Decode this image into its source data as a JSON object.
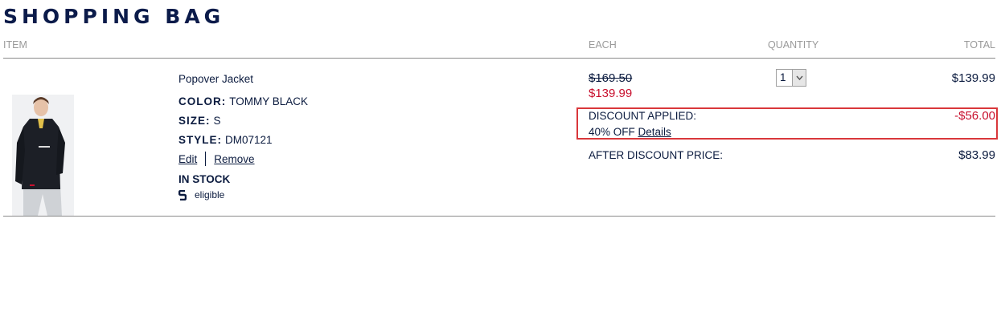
{
  "page": {
    "title": "SHOPPING BAG"
  },
  "table_headers": {
    "item": "ITEM",
    "each": "EACH",
    "quantity": "QUANTITY",
    "total": "TOTAL"
  },
  "item": {
    "name": "Popover Jacket",
    "color_label": "COLOR:",
    "color_value": "TOMMY BLACK",
    "size_label": "SIZE:",
    "size_value": "S",
    "style_label": "STYLE:",
    "style_value": "DM07121",
    "edit_label": "Edit",
    "remove_label": "Remove",
    "stock_status": "IN STOCK",
    "eligible_text": "eligible",
    "image_icon": "product-photo-jacket"
  },
  "pricing": {
    "original_price": "$169.50",
    "sale_price": "$139.99",
    "quantity": "1",
    "line_total": "$139.99",
    "discount_label": "DISCOUNT APPLIED:",
    "discount_amount": "-$56.00",
    "discount_detail": "40% OFF",
    "details_link": "Details",
    "after_discount_label": "AFTER DISCOUNT PRICE:",
    "after_discount_price": "$83.99"
  },
  "colors": {
    "navy": "#0b1b3f",
    "sale_red": "#c8102e",
    "highlight_border": "#d9373b",
    "header_gray": "#9a9a9a"
  }
}
